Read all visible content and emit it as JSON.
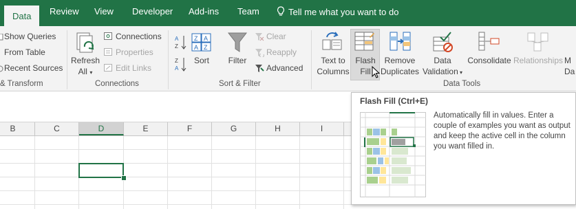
{
  "tabs": [
    {
      "label": "Data",
      "active": true
    },
    {
      "label": "Review"
    },
    {
      "label": "View"
    },
    {
      "label": "Developer"
    },
    {
      "label": "Add-ins"
    },
    {
      "label": "Team"
    }
  ],
  "tell_me": "Tell me what you want to do",
  "get_transform": {
    "items": [
      "Show Queries",
      "From Table",
      "Recent Sources"
    ],
    "label": "& Transform"
  },
  "connections": {
    "refresh_line1": "Refresh",
    "refresh_line2": "All",
    "items": [
      "Connections",
      "Properties",
      "Edit Links"
    ],
    "label": "Connections"
  },
  "sort_filter": {
    "sort": "Sort",
    "filter": "Filter",
    "clear": "Clear",
    "reapply": "Reapply",
    "advanced": "Advanced",
    "label": "Sort & Filter"
  },
  "data_tools": {
    "text_to_columns": [
      "Text to",
      "Columns"
    ],
    "flash_fill": [
      "Flash",
      "Fill"
    ],
    "remove_duplicates": [
      "Remove",
      "Duplicates"
    ],
    "data_validation": [
      "Data",
      "Validation"
    ],
    "consolidate": "Consolidate",
    "relationships": "Relationships",
    "manage_partial": [
      "M",
      "Da"
    ],
    "label": "Data Tools"
  },
  "columns": [
    "B",
    "C",
    "D",
    "E",
    "F",
    "G",
    "H",
    "I"
  ],
  "selected_column": "D",
  "tooltip": {
    "title": "Flash Fill (Ctrl+E)",
    "description": "Automatically fill in values. Enter a couple of examples you want as output and keep the active cell in the column you want filled in."
  },
  "colors": {
    "accent": "#217346",
    "ribbon_bg": "#f3f3f3",
    "header_bg": "#f1f1f1"
  }
}
